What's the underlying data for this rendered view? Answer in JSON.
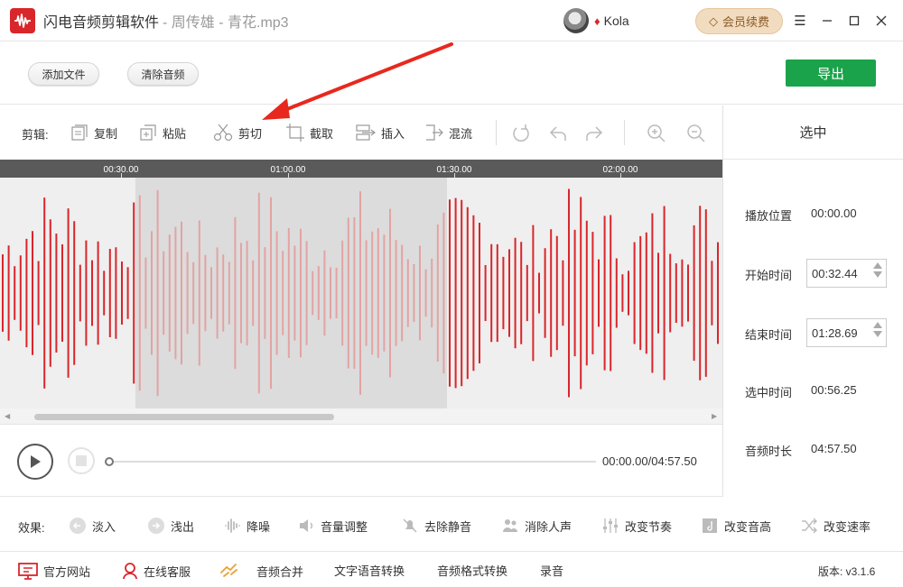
{
  "titlebar": {
    "app_name": "闪电音频剪辑软件",
    "file_suffix": "- 周传雄 - 青花.mp3",
    "username": "Kola",
    "vip_button": "会员续费"
  },
  "actions": {
    "add_file": "添加文件",
    "clear_audio": "清除音频",
    "export": "导出"
  },
  "edit_toolbar": {
    "label": "剪辑:",
    "copy": "复制",
    "paste": "粘贴",
    "cut": "剪切",
    "crop": "截取",
    "insert": "插入",
    "mix": "混流"
  },
  "timeline": {
    "ticks": [
      "00:30.00",
      "01:00.00",
      "01:30.00",
      "02:00.00"
    ]
  },
  "right_panel": {
    "title": "选中",
    "play_position_label": "播放位置",
    "play_position_value": "00:00.00",
    "start_time_label": "开始时间",
    "start_time_value": "00:32.44",
    "end_time_label": "结束时间",
    "end_time_value": "01:28.69",
    "selected_time_label": "选中时间",
    "selected_time_value": "00:56.25",
    "duration_label": "音频时长",
    "duration_value": "04:57.50"
  },
  "player": {
    "time_display": "00:00.00/04:57.50"
  },
  "effects": {
    "label": "效果:",
    "items": [
      "淡入",
      "浅出",
      "降噪",
      "音量调整",
      "去除静音",
      "消除人声",
      "改变节奏",
      "改变音高",
      "改变速率"
    ]
  },
  "footer": {
    "website": "官方网站",
    "support": "在线客服",
    "merge": "音频合并",
    "tts": "文字语音转换",
    "format": "音频格式转换",
    "record": "录音",
    "version": "版本: v3.1.6"
  },
  "colors": {
    "wave": "#d9262b",
    "wave_selected": "#e3a3a3",
    "export": "#1aa34a",
    "vip": "#f2dcc0"
  }
}
